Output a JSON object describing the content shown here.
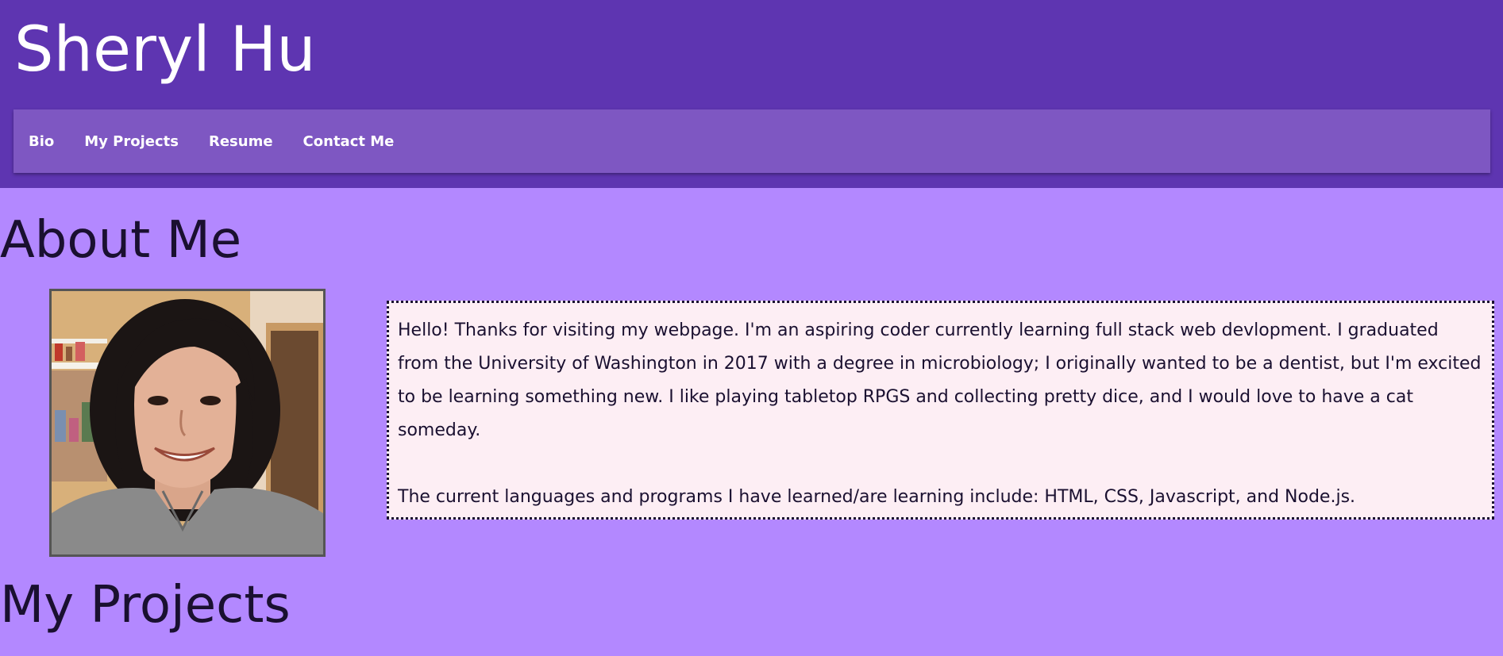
{
  "header": {
    "title": "Sheryl Hu"
  },
  "nav": {
    "items": [
      {
        "label": "Bio"
      },
      {
        "label": "My Projects"
      },
      {
        "label": "Resume"
      },
      {
        "label": "Contact Me"
      }
    ]
  },
  "about": {
    "heading": "About Me",
    "bio_paragraph_1": "Hello! Thanks for visiting my webpage. I'm an aspiring coder currently learning full stack web devlopment. I graduated from the University of Washington in 2017 with a degree in microbiology; I originally wanted to be a dentist, but I'm excited to be learning something new. I like playing tabletop RPGS and collecting pretty dice, and I would love to have a cat someday.",
    "bio_paragraph_2": "The current languages and programs I have learned/are learning include: HTML, CSS, Javascript, and Node.js."
  },
  "projects": {
    "heading": "My Projects"
  },
  "colors": {
    "page_background": "#b388ff",
    "header_background": "#5e35b1",
    "nav_background": "#7e57c2",
    "bio_background": "#fdeef4",
    "text": "#1a1030"
  }
}
